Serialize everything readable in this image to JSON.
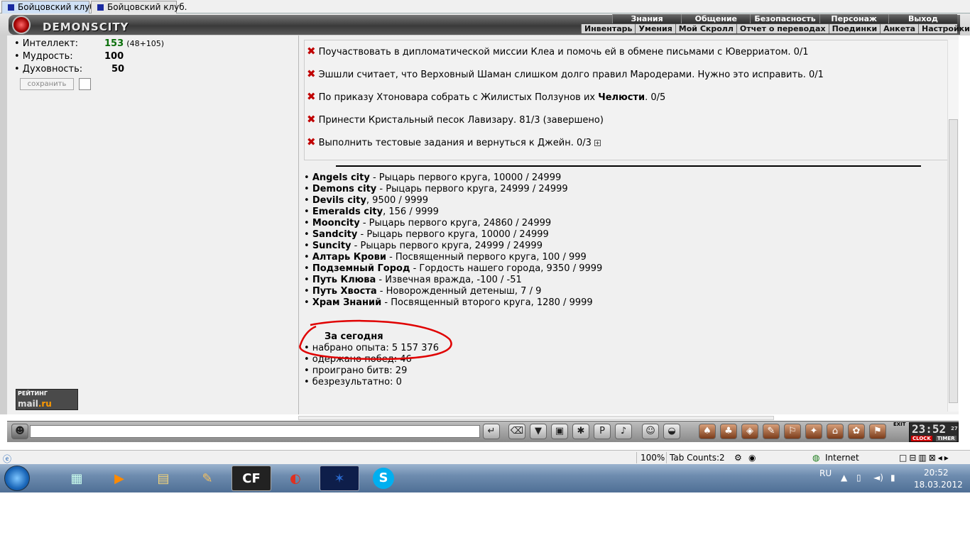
{
  "browser_tabs": [
    {
      "label": "Бойцовский клуб",
      "active": true
    },
    {
      "label": "Бойцовский клуб.",
      "active": false
    }
  ],
  "game": {
    "logo_text": "DEMONSCITY",
    "top_menu": [
      "Знания",
      "Общение",
      "Безопасность",
      "Персонаж",
      "Выход"
    ],
    "sub_menu": [
      "Инвентарь",
      "Умения",
      "Мой Скролл",
      "Отчет о переводах",
      "Поединки",
      "Анкета",
      "Настройки"
    ]
  },
  "stats": {
    "intellect_label": "• Интеллект:",
    "intellect_value": "153",
    "intellect_extra": "(48+105)",
    "wisdom_label": "• Мудрость:",
    "wisdom_value": "100",
    "spirit_label": "• Духовность:",
    "spirit_value": "50",
    "save_label": "сохранить"
  },
  "quests": [
    {
      "pre": "Поучаствовать в дипломатической миссии Клеа и помочь ей в обмене письмами с Юверриатом. 0/1",
      "bold": "",
      "post": ""
    },
    {
      "pre": "Эшшли считает, что Верховный Шаман слишком долго правил Мародерами. Нужно это исправить. 0/1",
      "bold": "",
      "post": ""
    },
    {
      "pre": "По приказу Хтоновара собрать с Жилистых Ползунов их ",
      "bold": "Челюсти",
      "post": ". 0/5"
    },
    {
      "pre": "Принести Кристальный песок Лавизару. 81/3 (завершено)",
      "bold": "",
      "post": ""
    },
    {
      "pre": "Выполнить тестовые задания и вернуться к Джейн. 0/3",
      "bold": "",
      "post": ""
    }
  ],
  "reputation": [
    {
      "name": "Angels city",
      "rest": " - Рыцарь первого круга, 10000 / 24999"
    },
    {
      "name": "Demons city",
      "rest": " - Рыцарь первого круга, 24999 / 24999"
    },
    {
      "name": "Devils city",
      "rest": ", 9500 / 9999"
    },
    {
      "name": "Emeralds city",
      "rest": ", 156 / 9999"
    },
    {
      "name": "Mooncity",
      "rest": " - Рыцарь первого круга, 24860 / 24999"
    },
    {
      "name": "Sandcity",
      "rest": " - Рыцарь первого круга, 10000 / 24999"
    },
    {
      "name": "Suncity",
      "rest": " - Рыцарь первого круга, 24999 / 24999"
    },
    {
      "name": "Алтарь Крови",
      "rest": " - Посвященный первого круга, 100 / 999"
    },
    {
      "name": "Подземный Город",
      "rest": " - Гордость нашего города, 9350 / 9999"
    },
    {
      "name": "Путь Клюва",
      "rest": " - Извечная вражда, -100 / -51"
    },
    {
      "name": "Путь Хвоста",
      "rest": " - Новорожденный детеныш, 7 / 9"
    },
    {
      "name": "Храм Знаний",
      "rest": " - Посвященный второго круга, 1280 / 9999"
    }
  ],
  "today": {
    "title": "За сегодня",
    "lines": [
      "• набрано опыта: 5 157 376",
      "• одержано побед: 46",
      "• проиграно битв: 29",
      "• безрезультатно: 0"
    ]
  },
  "rating": {
    "line1": "РЕЙТИНГ",
    "line2a": "mail",
    "line2b": ".ru"
  },
  "clock": {
    "time": "23:52",
    "seconds": "27",
    "label_clock": "CLOCK",
    "label_timer": "TIMER",
    "exit": "EXIT"
  },
  "ie_status": {
    "zoom": "100%",
    "tab_counts": "Tab Counts:2",
    "zone": "Internet"
  },
  "taskbar": {
    "lang": "RU",
    "time": "20:52",
    "date": "18.03.2012",
    "cf_label": "CF"
  },
  "colors": {
    "accent_red": "#c00000",
    "green": "#0a6f0a",
    "annotation": "#e00000"
  }
}
